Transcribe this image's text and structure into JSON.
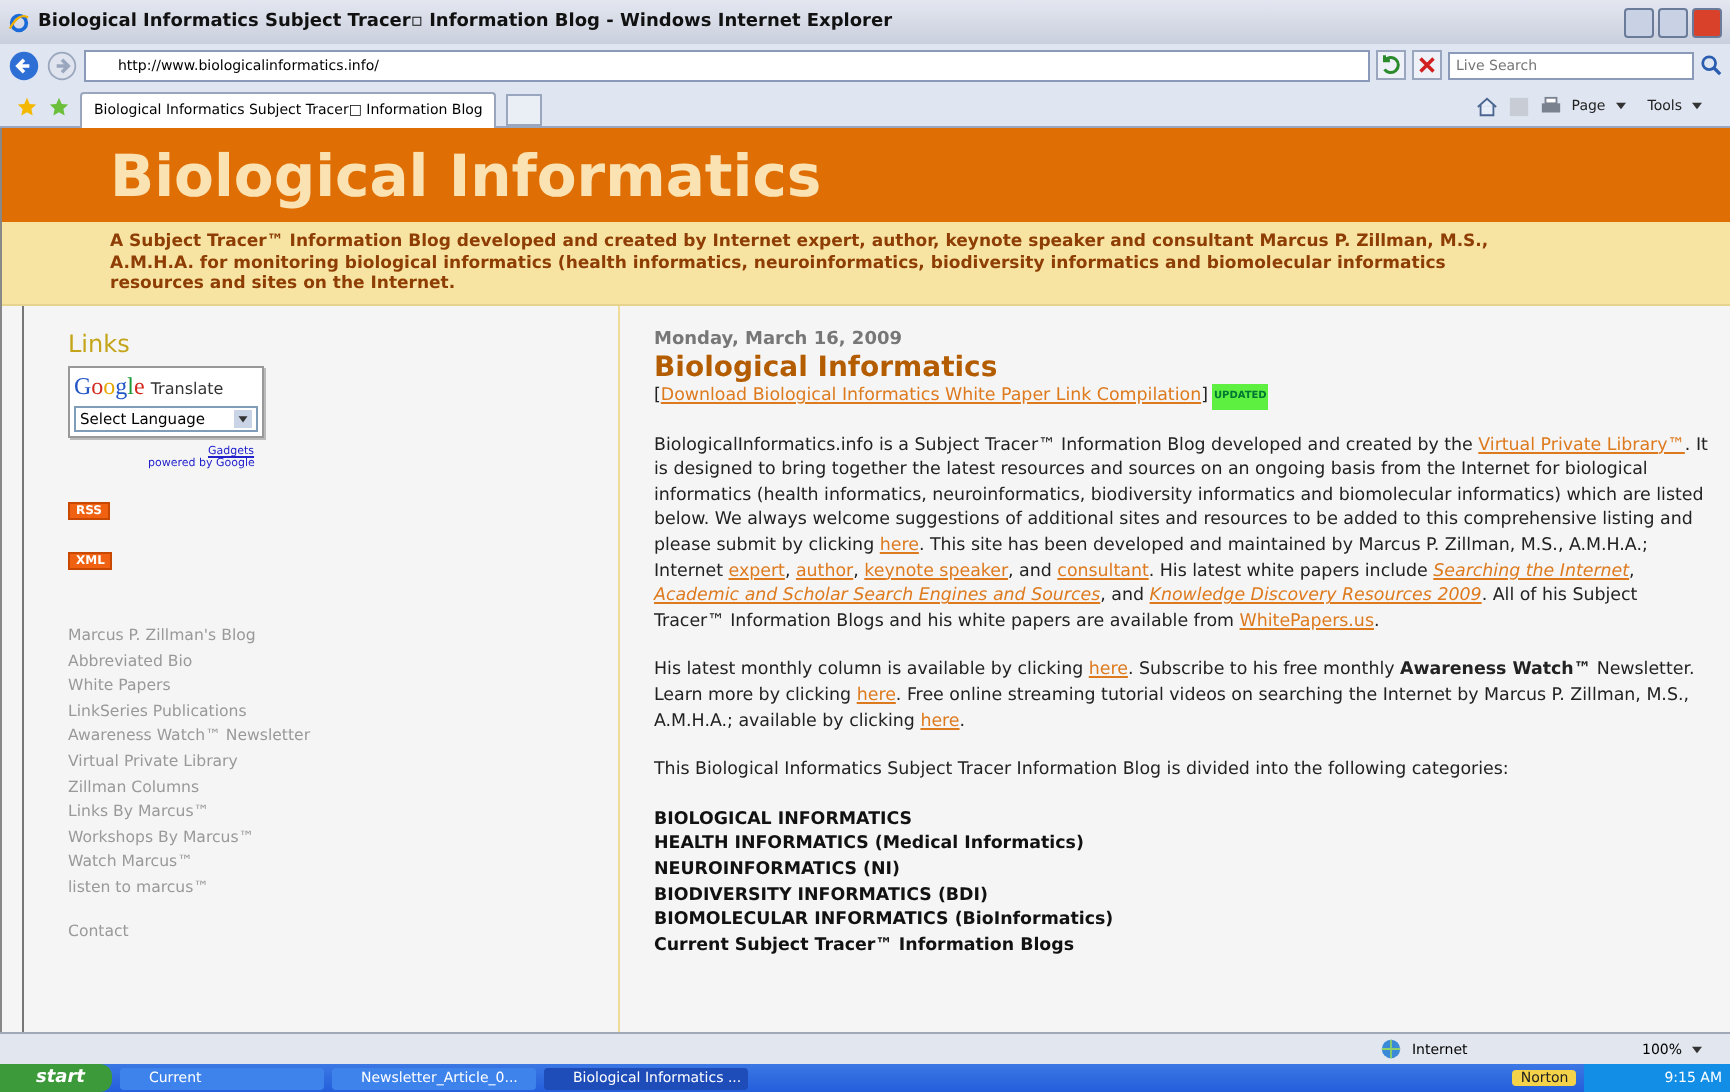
{
  "window": {
    "title": "Biological Informatics Subject Tracer▫ Information Blog - Windows Internet Explorer"
  },
  "nav": {
    "url": "http://www.biologicalinformatics.info/",
    "search_placeholder": "Live Search"
  },
  "tabs": [
    {
      "label": "Biological Informatics Subject Tracer□ Information Blog",
      "selected": true
    }
  ],
  "command_bar": [
    "Page",
    "Tools"
  ],
  "header": {
    "title": "Biological Informatics",
    "description": "A Subject Tracer™ Information Blog developed and created by Internet expert, author, keynote speaker and consultant Marcus P. Zillman, M.S., A.M.H.A. for monitoring biological informatics (health informatics, neuroinformatics, biodiversity informatics and biomolecular informatics resources and sites on the Internet."
  },
  "sidebar": {
    "heading": "Links",
    "translate": {
      "brand": "Google",
      "label": "Translate",
      "select_value": "Select Language",
      "gadgets": "Gadgets",
      "powered_by": "powered by Google"
    },
    "feed_badges": [
      "RSS",
      "XML"
    ],
    "links": [
      "Marcus P. Zillman's Blog",
      "Abbreviated Bio",
      "White Papers",
      "LinkSeries Publications",
      "Awareness Watch™ Newsletter",
      "Virtual Private Library",
      "Zillman Columns",
      "Links By Marcus™",
      "Workshops By Marcus™",
      "Watch Marcus™",
      "listen to marcus™"
    ],
    "contact": "Contact"
  },
  "post": {
    "date": "Monday, March 16, 2009",
    "title": "Biological Informatics",
    "open": "[",
    "download_link": "Download Biological Informatics White Paper Link Compilation",
    "close": "]",
    "badge": "UPDATED",
    "paragraphs": [
      [
        {
          "kind": "text",
          "text": "BiologicalInformatics.info is a Subject Tracer™ Information Blog developed and created by the "
        },
        {
          "kind": "link",
          "text": "Virtual Private Library™"
        },
        {
          "kind": "text",
          "text": ". It is designed to bring together the latest resources and sources on an ongoing basis from the Internet for biological informatics (health informatics, neuroinformatics, biodiversity informatics and biomolecular informatics) which are listed below. We always welcome suggestions of additional sites and resources to be added to this comprehensive listing and please submit by clicking "
        },
        {
          "kind": "link",
          "text": "here"
        },
        {
          "kind": "text",
          "text": ". This site has been developed and maintained by Marcus P. Zillman, M.S., A.M.H.A.; Internet "
        },
        {
          "kind": "link",
          "text": "expert"
        },
        {
          "kind": "text",
          "text": ", "
        },
        {
          "kind": "link",
          "text": "author"
        },
        {
          "kind": "text",
          "text": ", "
        },
        {
          "kind": "link",
          "text": "keynote speaker"
        },
        {
          "kind": "text",
          "text": ", and "
        },
        {
          "kind": "link",
          "text": "consultant"
        },
        {
          "kind": "text",
          "text": ". His latest white papers include "
        },
        {
          "kind": "italic-link",
          "text": "Searching the Internet"
        },
        {
          "kind": "text",
          "text": ", "
        },
        {
          "kind": "italic-link",
          "text": "Academic and Scholar Search Engines and Sources"
        },
        {
          "kind": "text",
          "text": ", and "
        },
        {
          "kind": "italic-link",
          "text": "Knowledge Discovery Resources 2009"
        },
        {
          "kind": "text",
          "text": ". All of his Subject Tracer™ Information Blogs and his white papers are available from "
        },
        {
          "kind": "link",
          "text": "WhitePapers.us"
        },
        {
          "kind": "text",
          "text": "."
        }
      ],
      [
        {
          "kind": "text",
          "text": "His latest monthly column is available by clicking "
        },
        {
          "kind": "link",
          "text": "here"
        },
        {
          "kind": "text",
          "text": ". Subscribe to his free monthly "
        },
        {
          "kind": "bold",
          "text": "Awareness Watch™"
        },
        {
          "kind": "text",
          "text": " Newsletter. Learn more by clicking "
        },
        {
          "kind": "link",
          "text": "here"
        },
        {
          "kind": "text",
          "text": ". Free online streaming tutorial videos on searching the Internet by Marcus P. Zillman, M.S., A.M.H.A.; available by clicking "
        },
        {
          "kind": "link",
          "text": "here"
        },
        {
          "kind": "text",
          "text": "."
        }
      ],
      [
        {
          "kind": "text",
          "text": "This Biological Informatics Subject Tracer Information Blog is divided into the following categories:"
        }
      ]
    ],
    "categories": [
      "BIOLOGICAL INFORMATICS",
      "HEALTH INFORMATICS (Medical Informatics)",
      "NEUROINFORMATICS (NI)",
      "BIODIVERSITY INFORMATICS (BDI)",
      "BIOMOLECULAR INFORMATICS (BioInformatics)",
      "Current Subject Tracer™ Information Blogs"
    ]
  },
  "status_bar": {
    "zone": "Internet",
    "zoom": "100%"
  },
  "taskbar": {
    "start": "start",
    "items": [
      {
        "label": "Current",
        "selected": false
      },
      {
        "label": "Newsletter_Article_0...",
        "selected": false
      },
      {
        "label": "Biological Informatics ...",
        "selected": true
      }
    ],
    "norton": "Norton",
    "clock": "9:15 AM"
  }
}
